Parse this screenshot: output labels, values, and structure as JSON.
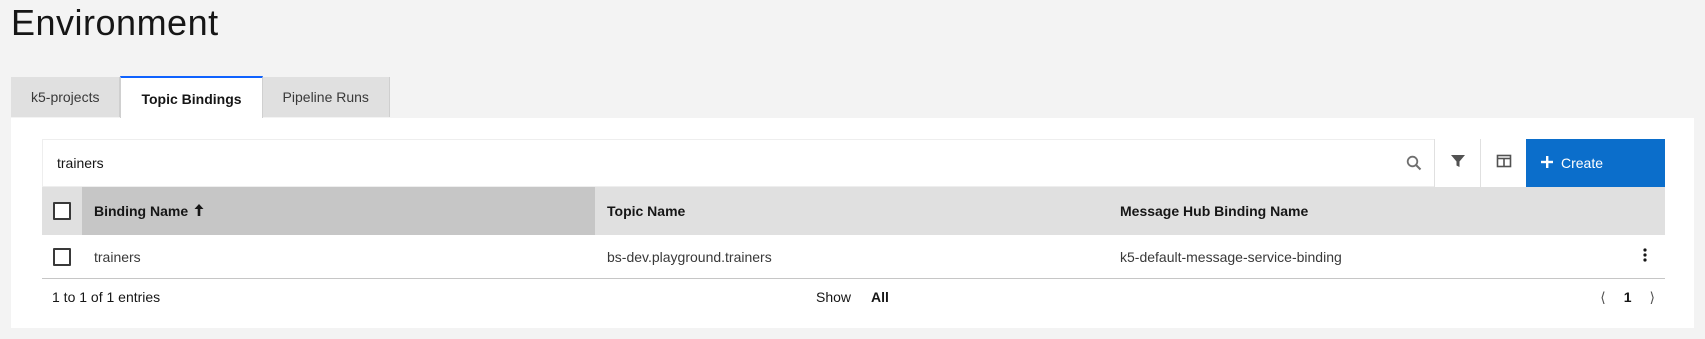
{
  "page": {
    "title": "Environment"
  },
  "tabs": [
    {
      "label": "k5-projects",
      "active": false
    },
    {
      "label": "Topic Bindings",
      "active": true
    },
    {
      "label": "Pipeline Runs",
      "active": false
    }
  ],
  "toolbar": {
    "search_value": "trainers",
    "search_icon": "search-icon",
    "filter_icon": "filter-icon",
    "columns_icon": "columns-icon",
    "create_label": "Create",
    "create_icon": "plus-icon",
    "accent_color": "#0b6ecb"
  },
  "table": {
    "columns": [
      "Binding Name",
      "Topic Name",
      "Message Hub Binding Name"
    ],
    "sort_indicator": "↑",
    "rows": [
      {
        "binding_name": "trainers",
        "topic_name": "bs-dev.playground.trainers",
        "hub_binding_name": "k5-default-message-service-binding"
      }
    ]
  },
  "footer": {
    "entries_text": "1 to 1 of 1 entries",
    "show_label": "Show",
    "show_value": "All",
    "prev_arrow": "⟨",
    "page": "1",
    "next_arrow": "⟩"
  }
}
